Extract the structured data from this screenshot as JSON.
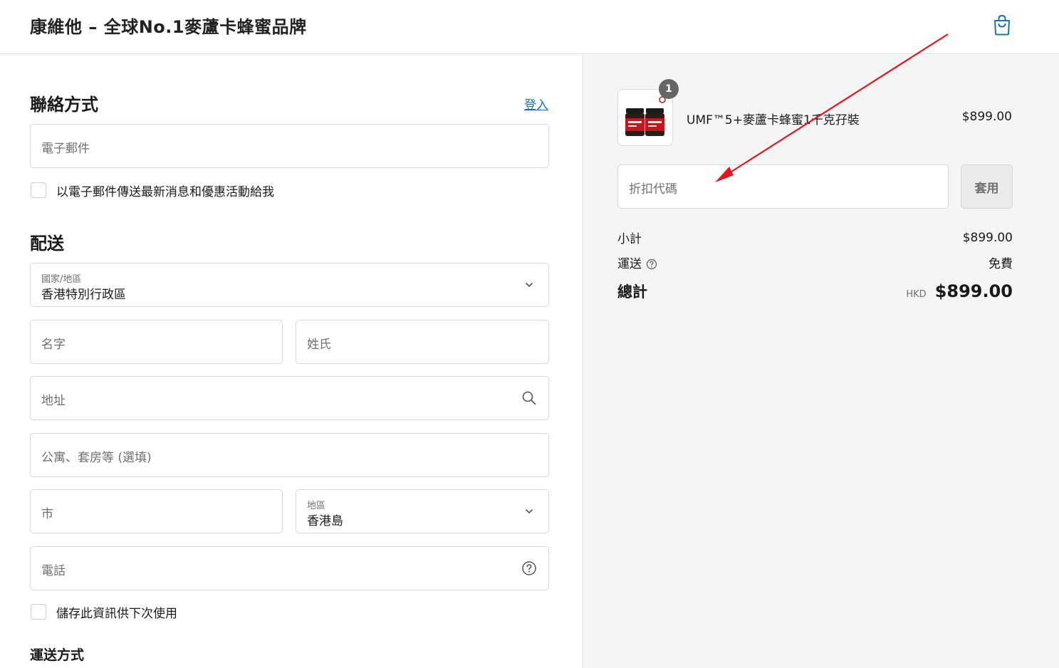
{
  "header": {
    "brand": "康維他 – 全球No.1麥蘆卡蜂蜜品牌",
    "cart_icon": "shopping-bag-icon"
  },
  "contact": {
    "title": "聯絡方式",
    "login_link": "登入",
    "email_placeholder": "電子郵件",
    "newsletter_label": "以電子郵件傳送最新消息和優惠活動給我"
  },
  "delivery": {
    "title": "配送",
    "country_label": "國家/地區",
    "country_value": "香港特別行政區",
    "first_name_placeholder": "名字",
    "last_name_placeholder": "姓氏",
    "address_placeholder": "地址",
    "apartment_placeholder": "公寓、套房等 (選填)",
    "city_placeholder": "市",
    "region_label": "地區",
    "region_value": "香港島",
    "phone_placeholder": "電話",
    "save_info_label": "儲存此資訊供下次使用",
    "shipping_method_title": "運送方式"
  },
  "summary": {
    "item": {
      "quantity": "1",
      "name": "UMF™5+麥蘆卡蜂蜜1千克孖裝",
      "price": "$899.00"
    },
    "discount_placeholder": "折扣代碼",
    "apply_label": "套用",
    "subtotal_label": "小計",
    "subtotal_value": "$899.00",
    "shipping_label": "運送",
    "shipping_value": "免費",
    "total_label": "總計",
    "currency": "HKD",
    "total_value": "$899.00"
  },
  "colors": {
    "link": "#1773b0",
    "annotation_arrow": "#e8141c",
    "summary_bg": "#f5f5f5"
  }
}
